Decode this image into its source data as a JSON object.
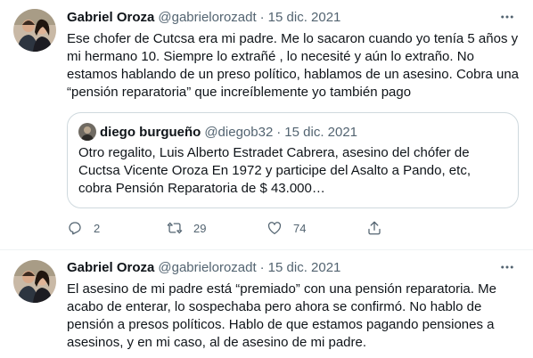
{
  "colors": {
    "text": "#0f1419",
    "secondary": "#536471",
    "border": "#cfd9de",
    "divider": "#eff3f4"
  },
  "tweet1": {
    "name": "Gabriel Oroza",
    "handle": "@gabrielorozadt",
    "dot": "·",
    "date": "15 dic. 2021",
    "text": "Ese chofer de Cutcsa era mi padre. Me lo sacaron cuando yo tenía 5 años y mi hermano 10. Siempre lo extrañé , lo necesité y aún lo extraño. No estamos hablando de un preso político, hablamos de un asesino. Cobra una “pensión reparatoria” que increíblemente yo también pago",
    "quote": {
      "name": "diego burgueño",
      "handle": "@diegob32",
      "dot": "·",
      "date": "15 dic. 2021",
      "text": "Otro regalito, Luis Alberto Estradet Cabrera, asesino del chófer de Cuctsa Vicente Oroza En 1972 y participe del Asalto a Pando, etc, cobra Pensión Reparatoria de $ 43.000…"
    },
    "actions": {
      "replies": "2",
      "retweets": "29",
      "likes": "74"
    }
  },
  "tweet2": {
    "name": "Gabriel Oroza",
    "handle": "@gabrielorozadt",
    "dot": "·",
    "date": "15 dic. 2021",
    "text": "El asesino de mi padre está “premiado” con una pensión reparatoria. Me acabo de enterar, lo sospechaba pero ahora se confirmó. No hablo de pensión a presos políticos. Hablo de que estamos pagando pensiones a asesinos, y en mi caso, al de asesino de mi padre."
  },
  "icons": [
    "more-icon",
    "reply-icon",
    "retweet-icon",
    "like-icon",
    "share-icon"
  ]
}
